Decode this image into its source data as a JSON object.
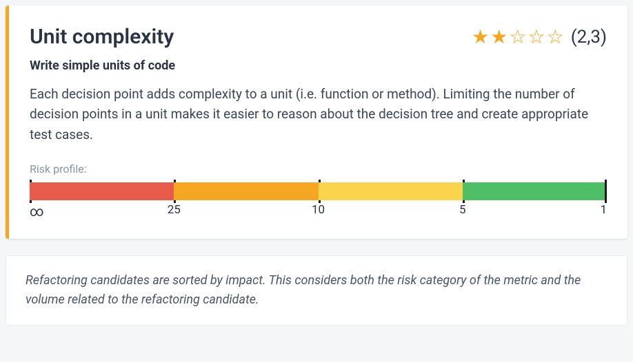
{
  "card": {
    "title": "Unit complexity",
    "rating": {
      "filled": 2,
      "total": 5,
      "score": "(2,3)"
    },
    "subtitle": "Write simple units of code",
    "description": "Each decision point adds complexity to a unit (i.e. function or method). Limiting the number of decision points in a unit makes it easier to reason about the decision tree and create appropriate test cases.",
    "risk_label": "Risk profile:",
    "risk_ticks": [
      "∞",
      "25",
      "10",
      "5",
      "1"
    ],
    "risk_colors": [
      "#e85b4b",
      "#f5a623",
      "#fcd34d",
      "#4fbf67"
    ]
  },
  "note": {
    "text": "Refactoring candidates are sorted by impact. This considers both the risk category of the metric and the volume related to the refactoring candidate."
  }
}
